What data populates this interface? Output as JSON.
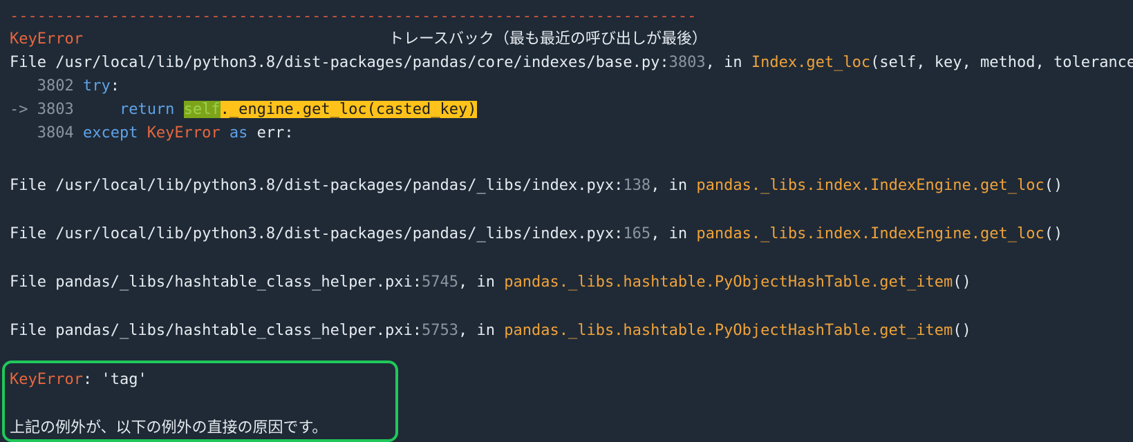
{
  "separator": "---------------------------------------------------------------------------",
  "exception_name": "KeyError",
  "traceback_header": "トレースバック（最も最近の呼び出しが最後）",
  "frames": [
    {
      "file_prefix": "File /usr/local/lib/python3.8/dist-packages/pandas/core/indexes/base.py:",
      "line_no": "3803",
      "in_word": ", in ",
      "func": "Index.get_loc",
      "args": "(self, key, method, tolerance)"
    },
    {
      "file_prefix": "File /usr/local/lib/python3.8/dist-packages/pandas/_libs/index.pyx:",
      "line_no": "138",
      "in_word": ", in ",
      "func": "pandas._libs.index.IndexEngine.get_loc",
      "args": "()"
    },
    {
      "file_prefix": "File /usr/local/lib/python3.8/dist-packages/pandas/_libs/index.pyx:",
      "line_no": "165",
      "in_word": ", in ",
      "func": "pandas._libs.index.IndexEngine.get_loc",
      "args": "()"
    },
    {
      "file_prefix": "File pandas/_libs/hashtable_class_helper.pxi:",
      "line_no": "5745",
      "in_word": ", in ",
      "func": "pandas._libs.hashtable.PyObjectHashTable.get_item",
      "args": "()"
    },
    {
      "file_prefix": "File pandas/_libs/hashtable_class_helper.pxi:",
      "line_no": "5753",
      "in_word": ", in ",
      "func": "pandas._libs.hashtable.PyObjectHashTable.get_item",
      "args": "()"
    }
  ],
  "code": {
    "l1_no": "   3802 ",
    "l1_kw": "try",
    "l1_colon": ":",
    "l2_no": "-> 3803     ",
    "l2_kw": "return ",
    "l2_self": "self",
    "l2_rest": "._engine.get_loc(casted_key)",
    "l3_no": "   3804 ",
    "l3_kw": "except ",
    "l3_exc": "KeyError",
    "l3_as": " as ",
    "l3_var": "err:"
  },
  "final_error": {
    "name": "KeyError",
    "message": ": 'tag'",
    "note": "上記の例外が、以下の例外の直接の原因です。"
  },
  "colors": {
    "background": "#1f2a36",
    "exception": "#e8663e",
    "keyword": "#5fa2e8",
    "function": "#f0a23a",
    "line_number": "#8b95a1",
    "highlight_box": "#20c85b"
  }
}
